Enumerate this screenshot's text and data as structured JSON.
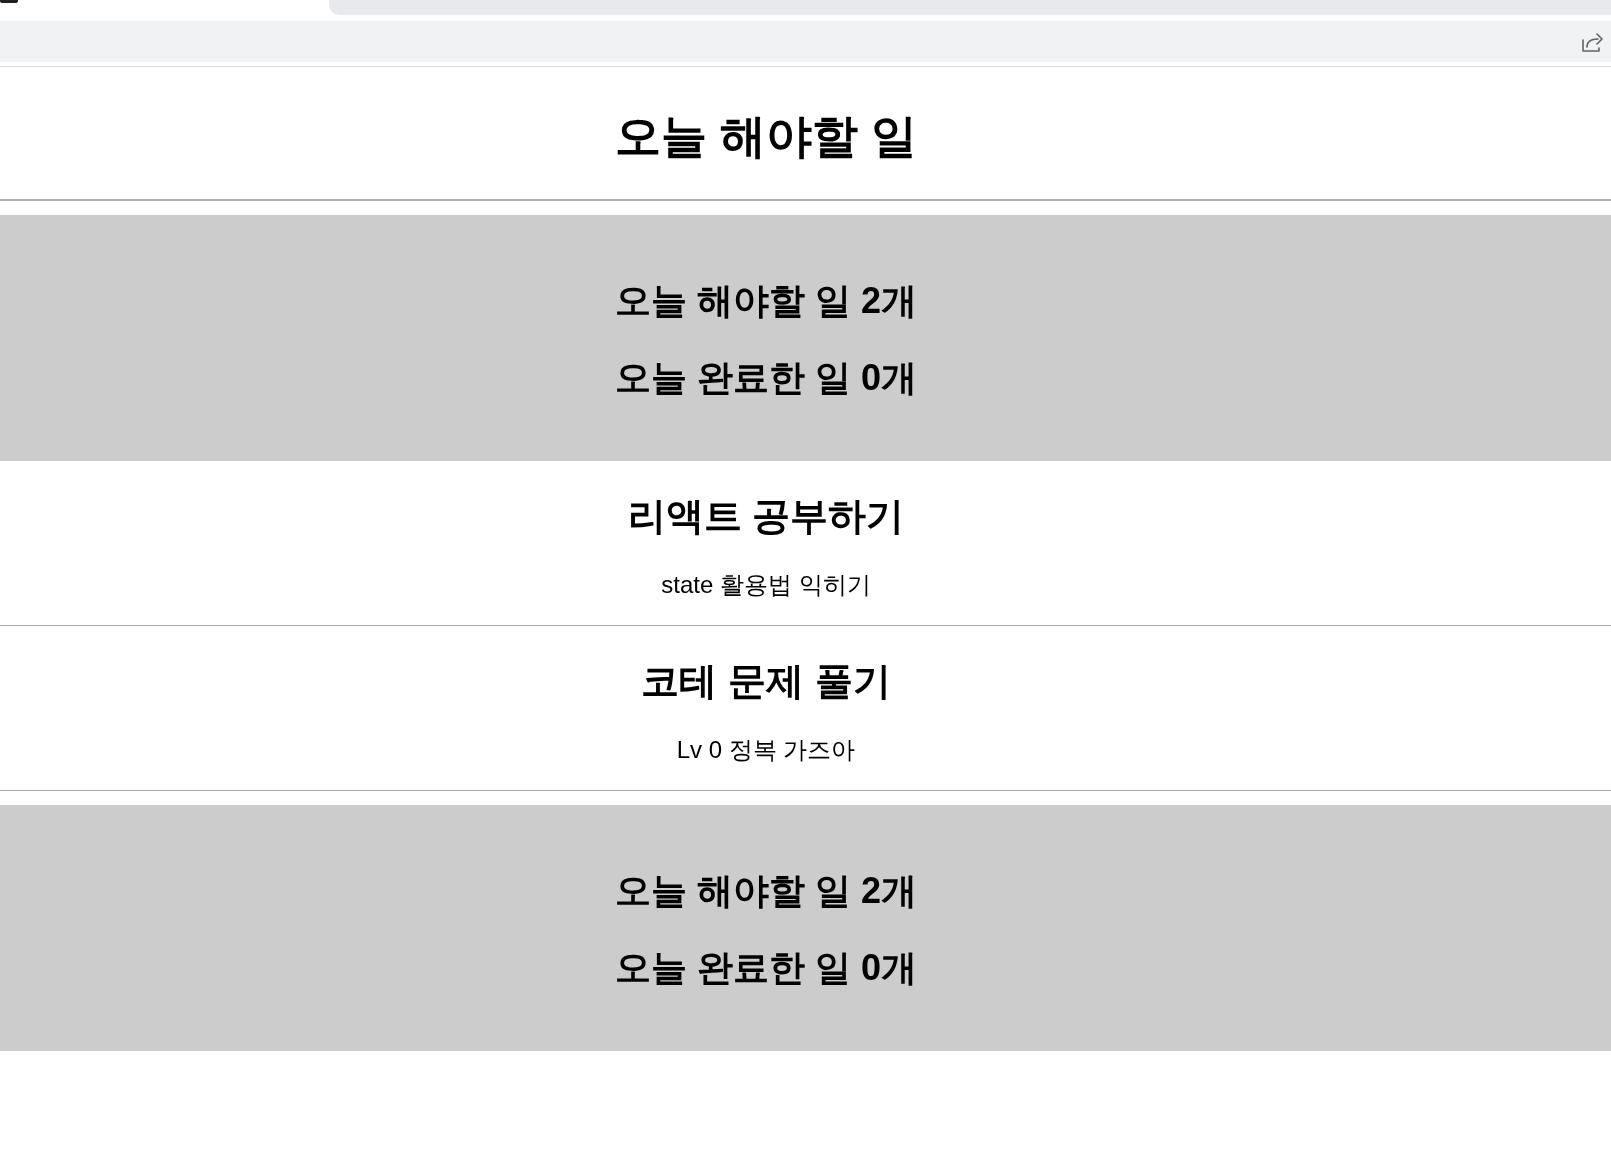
{
  "header": {
    "title": "오늘 해야할 일"
  },
  "sections": [
    {
      "kind": "summary",
      "lines": [
        "오늘 해야할 일 2개",
        "오늘 완료한 일 0개"
      ]
    },
    {
      "kind": "todo_list",
      "items": [
        {
          "title": "리액트 공부하기",
          "description": "state 활용법 익히기"
        },
        {
          "title": "코테 문제 풀기",
          "description": "Lv 0 정복 가즈아"
        }
      ]
    },
    {
      "kind": "summary",
      "lines": [
        "오늘 해야할 일 2개",
        "오늘 완료한 일 0개"
      ]
    }
  ]
}
